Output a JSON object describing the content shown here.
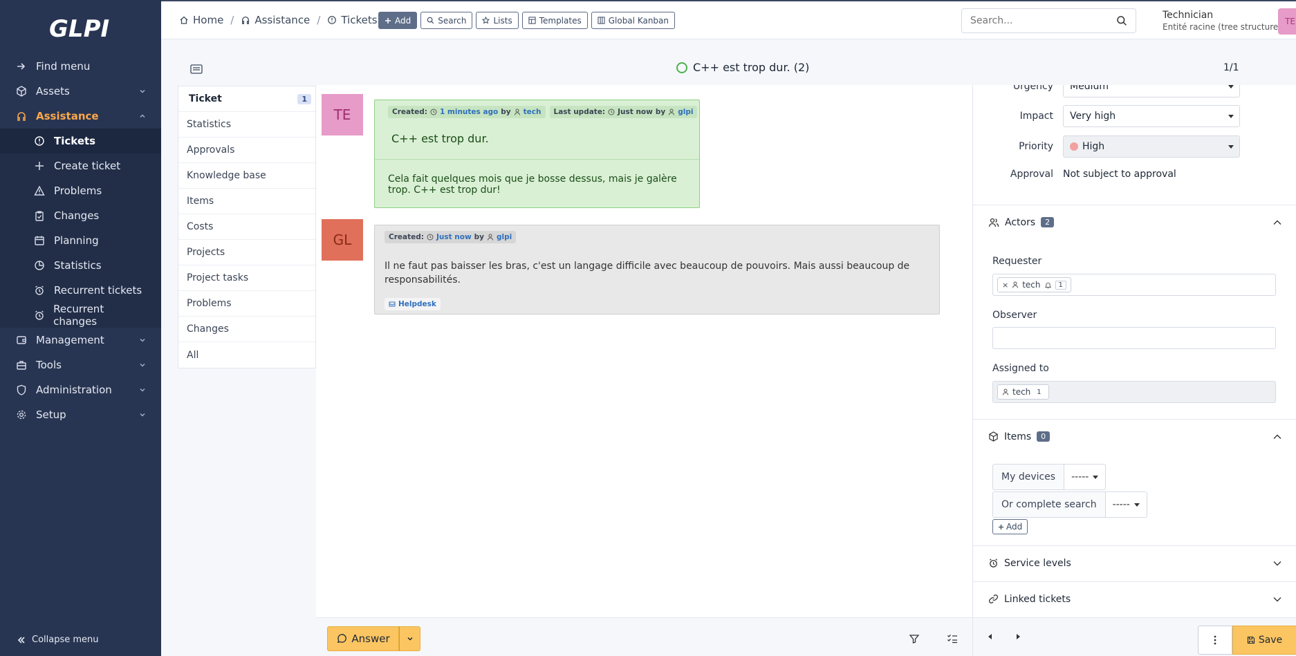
{
  "app": {
    "logo_text": "GLPI"
  },
  "sidebar": {
    "find_menu": "Find menu",
    "sections": [
      {
        "label": "Assets"
      },
      {
        "label": "Assistance"
      },
      {
        "label": "Management"
      },
      {
        "label": "Tools"
      },
      {
        "label": "Administration"
      },
      {
        "label": "Setup"
      }
    ],
    "assistance_items": [
      {
        "label": "Tickets"
      },
      {
        "label": "Create ticket"
      },
      {
        "label": "Problems"
      },
      {
        "label": "Changes"
      },
      {
        "label": "Planning"
      },
      {
        "label": "Statistics"
      },
      {
        "label": "Recurrent tickets"
      },
      {
        "label": "Recurrent changes"
      }
    ],
    "collapse": "Collapse menu"
  },
  "breadcrumb": [
    "Home",
    "Assistance",
    "Tickets"
  ],
  "header_actions": {
    "add": "Add",
    "search": "Search",
    "lists": "Lists",
    "templates": "Templates",
    "kanban": "Global Kanban"
  },
  "search": {
    "placeholder": "Search..."
  },
  "user": {
    "profile": "Technician",
    "entity": "Entité racine (tree structure)",
    "avatar_initials": "TE"
  },
  "ticket": {
    "title": "C++ est trop dur. (2)",
    "pager": "1/1"
  },
  "tabs": [
    {
      "label": "Ticket",
      "count": "1"
    },
    {
      "label": "Statistics"
    },
    {
      "label": "Approvals"
    },
    {
      "label": "Knowledge base"
    },
    {
      "label": "Items"
    },
    {
      "label": "Costs"
    },
    {
      "label": "Projects"
    },
    {
      "label": "Project tasks"
    },
    {
      "label": "Problems"
    },
    {
      "label": "Changes"
    },
    {
      "label": "All"
    }
  ],
  "timeline": {
    "item1": {
      "initials": "TE",
      "created_label": "Created:",
      "created_time": "1 minutes ago",
      "by": "by",
      "created_user": "tech",
      "update_label": "Last update:",
      "update_time": "Just now",
      "update_by": "by",
      "update_user": "glpi",
      "title": "C++ est trop dur.",
      "content": "Cela fait quelques mois que je bosse dessus, mais je galère trop. C++ est trop dur!"
    },
    "item2": {
      "initials": "GL",
      "created_label": "Created:",
      "created_time": "Just now",
      "by": "by",
      "created_user": "glpi",
      "content": "Il ne faut pas baisser les bras, c'est un langage difficile avec beaucoup de pouvoirs. Mais aussi beaucoup de responsabilités.",
      "source": "Helpdesk"
    }
  },
  "fields": {
    "urgency_label": "Urgency",
    "urgency_value": "Medium",
    "impact_label": "Impact",
    "impact_value": "Very high",
    "priority_label": "Priority",
    "priority_value": "High",
    "approval_label": "Approval",
    "approval_value": "Not subject to approval"
  },
  "actors": {
    "title": "Actors",
    "count": "2",
    "requester_label": "Requester",
    "requester_user": "tech",
    "requester_count": "1",
    "observer_label": "Observer",
    "assigned_label": "Assigned to",
    "assigned_user": "tech",
    "assigned_count": "1"
  },
  "items": {
    "title": "Items",
    "count": "0",
    "my_devices": "My devices",
    "my_devices_value": "-----",
    "complete_search": "Or complete search",
    "complete_search_value": "-----",
    "add": "Add"
  },
  "service_levels": "Service levels",
  "linked_tickets": "Linked tickets",
  "footer": {
    "answer": "Answer",
    "save": "Save"
  },
  "colors": {
    "sidebar_bg": "#283552",
    "accent": "#fca84a",
    "primary_btn": "#fbc562",
    "followup_bg": "#e8e8e8",
    "ticket_bg": "#d9f0d5"
  }
}
